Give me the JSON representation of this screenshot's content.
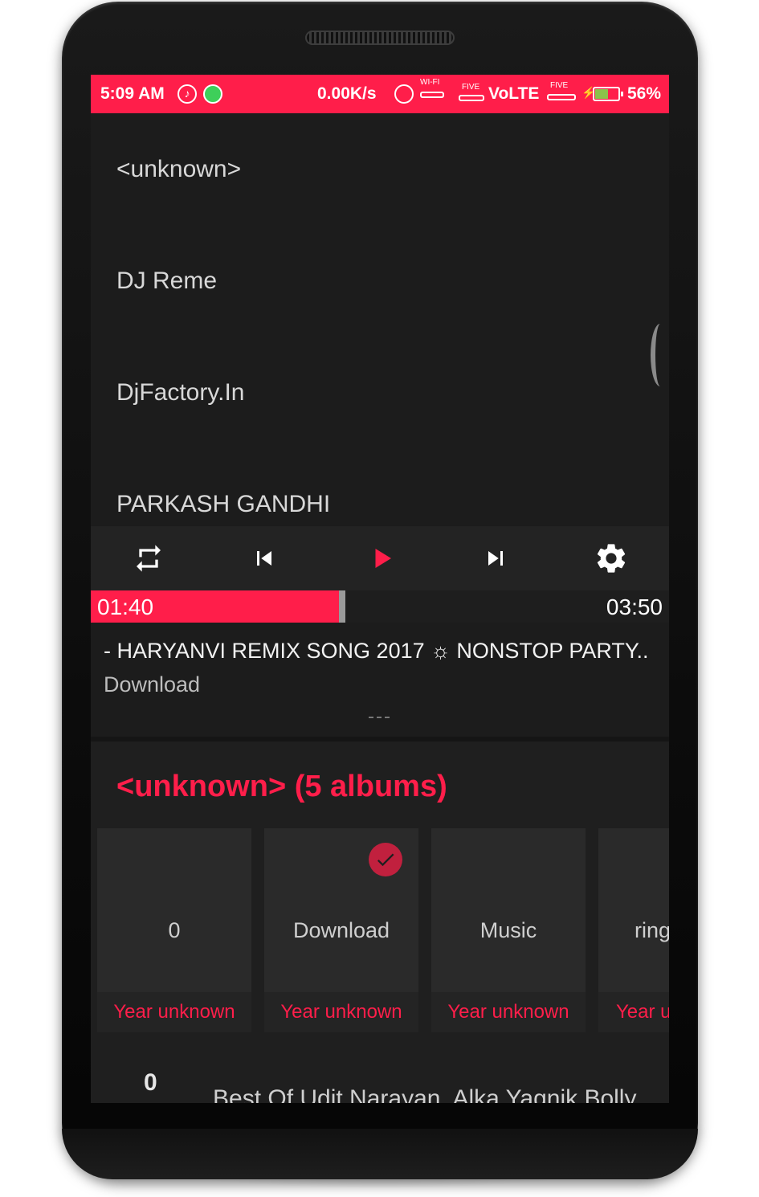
{
  "status_bar": {
    "time": "5:09 AM",
    "net_speed": "0.00K/s",
    "wifi_label": "WI-FI",
    "sim1_label": "FIVE",
    "volte": "VoLTE",
    "sim2_label": "FIVE",
    "battery_percent": "56%",
    "battery_level": 0.56,
    "accent_color": "#ff1e4a"
  },
  "artists": [
    {
      "name": "<unknown>"
    },
    {
      "name": "DJ Reme"
    },
    {
      "name": "DjFactory.In"
    },
    {
      "name": "PARKASH GANDHI"
    }
  ],
  "player": {
    "controls": {
      "repeat_icon": "repeat-icon",
      "previous_icon": "skip-previous-icon",
      "play_icon": "play-icon",
      "next_icon": "skip-next-icon",
      "settings_icon": "settings-gear-icon"
    },
    "current_time": "01:40",
    "total_time": "03:50",
    "progress": 0.4348,
    "track_title": "- HARYANVI REMIX SONG 2017 ☼ NONSTOP PARTY..",
    "album": "Download"
  },
  "albums_section": {
    "heading": "<unknown> (5 albums)",
    "albums": [
      {
        "name": "0",
        "year": "Year unknown",
        "selected": false
      },
      {
        "name": "Download",
        "year": "Year unknown",
        "selected": true
      },
      {
        "name": "Music",
        "year": "Year unknown",
        "selected": false
      },
      {
        "name": "ring",
        "year": "Year unknown",
        "selected": false
      }
    ]
  },
  "tracks": [
    {
      "number": "0",
      "title": "Best Of Udit Narayan, Alka Yagnik Bolly"
    }
  ]
}
